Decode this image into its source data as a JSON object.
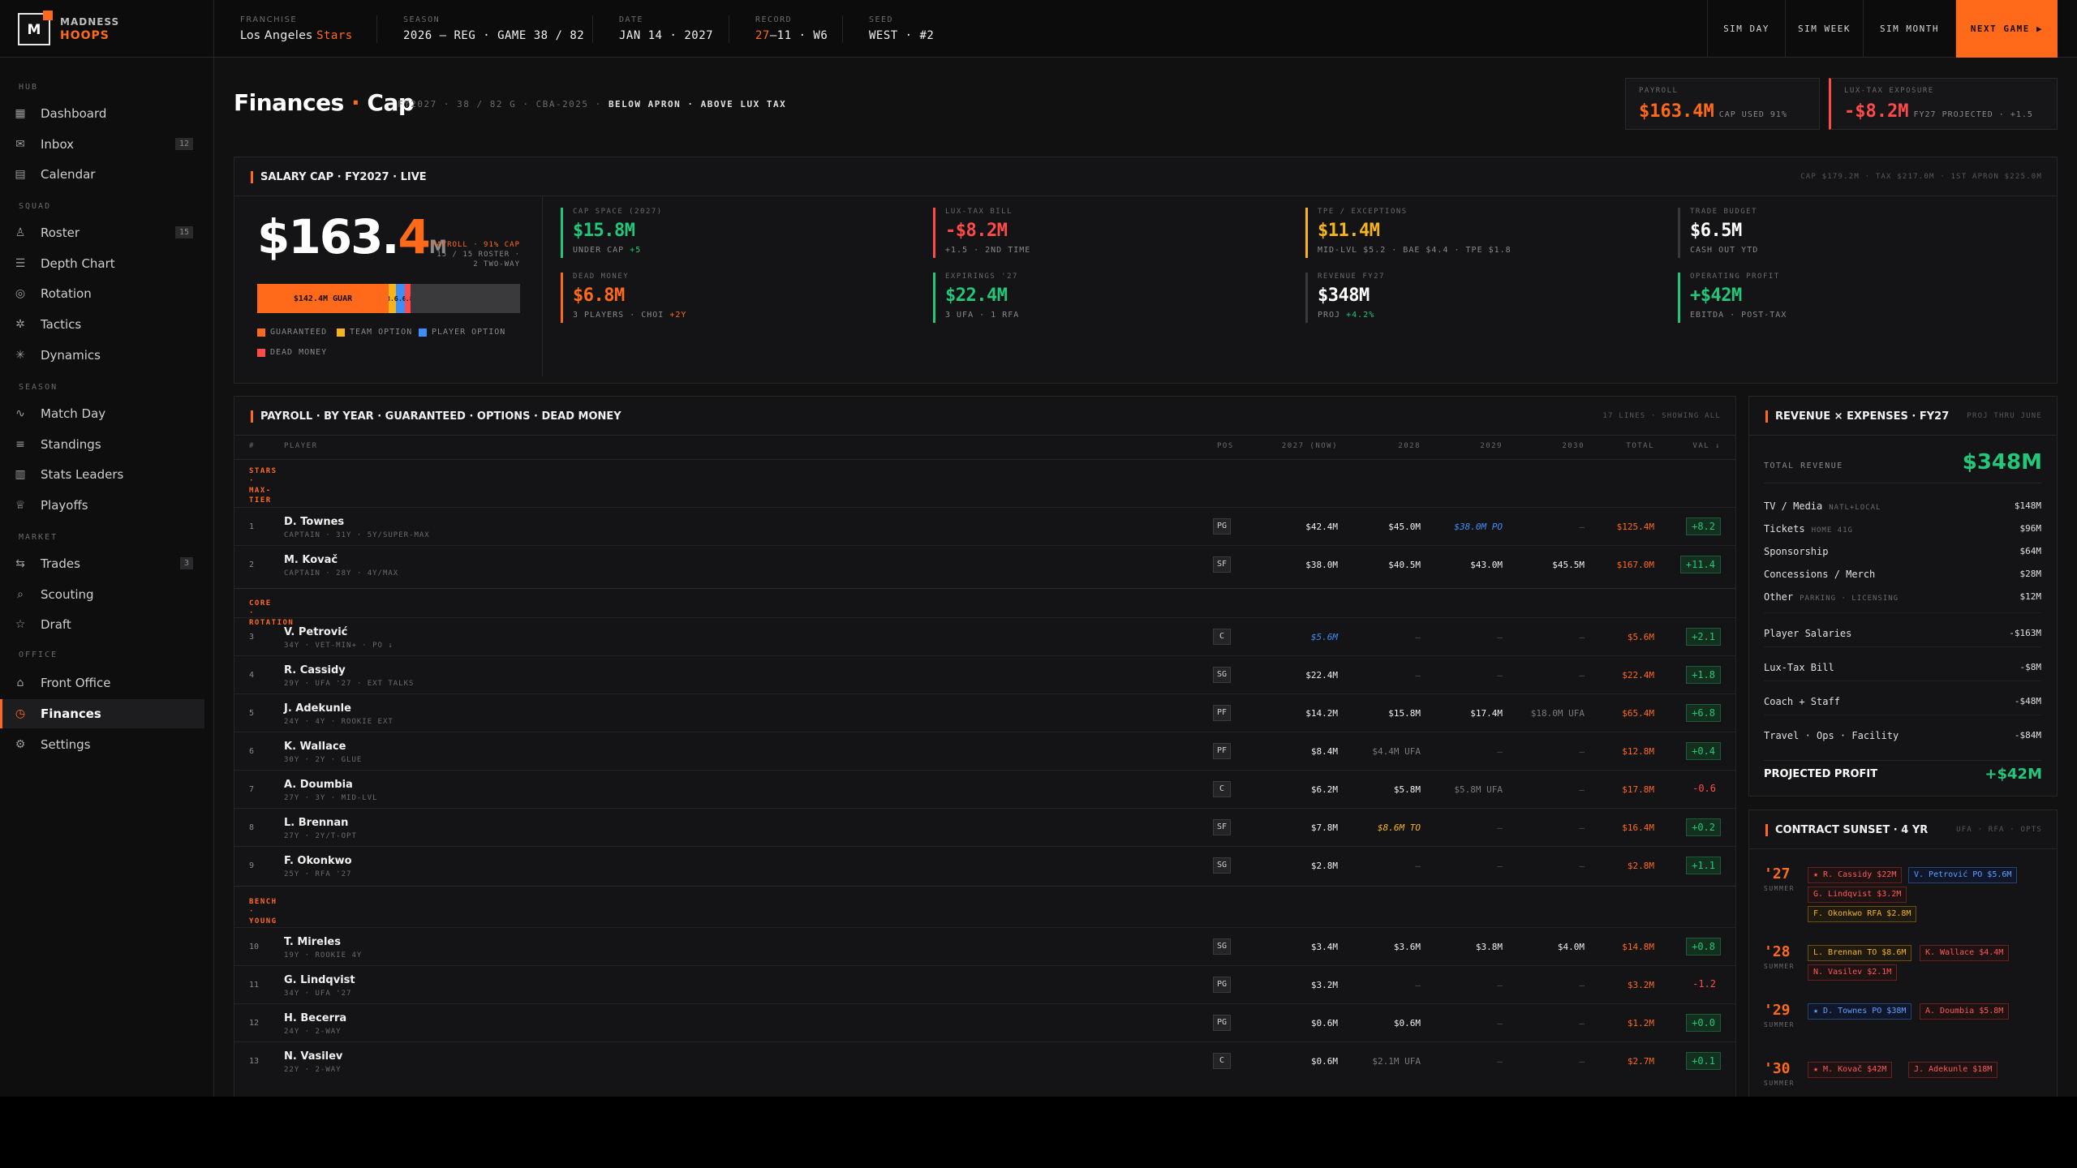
{
  "brand": {
    "line1": "MADNESS",
    "line2": "HOOPS",
    "mark": "M"
  },
  "topbar": {
    "franchise_label": "FRANCHISE",
    "franchise_city": "Los Angeles",
    "franchise_team": "Stars",
    "season_label": "SEASON",
    "season_value": "2026 — REG · GAME 38 / 82",
    "date_label": "DATE",
    "date_value": "JAN 14 · 2027",
    "record_label": "RECORD",
    "record_wins": "27",
    "record_rest": "–11 · W6",
    "seed_label": "SEED",
    "seed_value": "WEST · #2",
    "buttons": {
      "sim_day": "SIM DAY",
      "sim_week": "SIM WEEK",
      "sim_month": "SIM MONTH",
      "next_game": "NEXT GAME ▶"
    }
  },
  "sidebar": {
    "sections": {
      "hub": "HUB",
      "squad": "SQUAD",
      "season": "SEASON",
      "market": "MARKET",
      "office": "OFFICE"
    },
    "items": [
      {
        "label": "Dashboard",
        "icon": "grid-icon"
      },
      {
        "label": "Inbox",
        "icon": "mail-icon",
        "badge": "12"
      },
      {
        "label": "Calendar",
        "icon": "calendar-icon"
      },
      {
        "label": "Roster",
        "icon": "person-icon",
        "badge": "15"
      },
      {
        "label": "Depth Chart",
        "icon": "layers-icon"
      },
      {
        "label": "Rotation",
        "icon": "rotation-icon"
      },
      {
        "label": "Tactics",
        "icon": "tactics-icon"
      },
      {
        "label": "Dynamics",
        "icon": "dynamics-icon"
      },
      {
        "label": "Match Day",
        "icon": "pulse-icon"
      },
      {
        "label": "Standings",
        "icon": "list-icon"
      },
      {
        "label": "Stats Leaders",
        "icon": "bars-icon"
      },
      {
        "label": "Playoffs",
        "icon": "trophy-icon"
      },
      {
        "label": "Trades",
        "icon": "swap-icon",
        "badge": "3"
      },
      {
        "label": "Scouting",
        "icon": "search-icon"
      },
      {
        "label": "Draft",
        "icon": "star-icon"
      },
      {
        "label": "Front Office",
        "icon": "building-icon"
      },
      {
        "label": "Finances",
        "icon": "clock-icon"
      },
      {
        "label": "Settings",
        "icon": "gear-icon"
      }
    ]
  },
  "header": {
    "title_a": "Finances",
    "title_dot": "·",
    "title_b": "Cap",
    "meta": "FY2027 · 38 / 82 G · CBA-2025 ·",
    "meta_bold": "BELOW APRON · ABOVE LUX TAX",
    "kpi_payroll": {
      "label": "PAYROLL",
      "value": "$163.4M",
      "sub": "CAP USED 91%"
    },
    "kpi_tax": {
      "label": "LUX-TAX EXPOSURE",
      "value": "-$8.2M",
      "sub": "FY27 PROJECTED · +1.5"
    }
  },
  "cap": {
    "title": "SALARY CAP · FY2027 · LIVE",
    "right": "CAP $179.2M · TAX $217.0M · 1ST APRON $225.0M",
    "big_int": "$163.",
    "big_dec": "4",
    "big_unit": "M",
    "note_a": "PAYROLL · 91% CAP",
    "note_b": "15 / 15 ROSTER ·",
    "note_c": "2 TWO-WAY",
    "bar": [
      {
        "label": "$142.4M GUAR",
        "pct": 0.5,
        "color": "#ff6a1a"
      },
      {
        "label": "$8.6M TO",
        "pct": 0.027,
        "color": "#f5b51a"
      },
      {
        "label": "$5.6M PO",
        "pct": 0.035,
        "color": "#3e8ef7"
      },
      {
        "label": "$6.8M DM",
        "pct": 0.02,
        "color": "#ff4a4a"
      }
    ],
    "bar_labels": {
      "l1": "$142.4M GUAR",
      "l2": "$8.6M",
      "l3": "$5.6M",
      "l4": "$6.8M"
    },
    "legend": {
      "guaranteed": "GUARANTEED",
      "team_option": "TEAM OPTION",
      "player_option": "PLAYER OPTION",
      "dead_money": "DEAD MONEY"
    },
    "stats": [
      {
        "label": "CAP SPACE (2027)",
        "value": "$15.8M",
        "sub": "UNDER CAP",
        "sub_extra": "+5"
      },
      {
        "label": "LUX-TAX BILL",
        "value": "-$8.2M",
        "sub": "+1.5 · 2ND TIME"
      },
      {
        "label": "TPE / EXCEPTIONS",
        "value": "$11.4M",
        "sub": "MID-LVL $5.2 · BAE $4.4 · TPE $1.8"
      },
      {
        "label": "TRADE BUDGET",
        "value": "$6.5M",
        "sub": "CASH OUT YTD"
      },
      {
        "label": "DEAD MONEY",
        "value": "$6.8M",
        "sub": "3 PLAYERS · CHOI",
        "sub_extra": "+2Y"
      },
      {
        "label": "EXPIRINGS '27",
        "value": "$22.4M",
        "sub": "3 UFA · 1 RFA"
      },
      {
        "label": "REVENUE FY27",
        "value": "$348M",
        "sub": "PROJ",
        "sub_extra": "+4.2%"
      },
      {
        "label": "OPERATING PROFIT",
        "value": "+$42M",
        "sub": "EBITDA · POST-TAX"
      }
    ]
  },
  "payroll": {
    "title": "PAYROLL · BY YEAR · GUARANTEED · OPTIONS · DEAD MONEY",
    "right": "17 LINES · SHOWING ALL",
    "headers": {
      "num": "#",
      "player": "PLAYER",
      "pos": "POS",
      "y2027": "2027 (NOW)",
      "y2028": "2028",
      "y2029": "2029",
      "y2030": "2030",
      "total": "TOTAL",
      "val": "VAL ↓"
    },
    "groups": {
      "stars": [
        "STARS",
        "·",
        "MAX-",
        "TIER"
      ],
      "core": [
        "CORE",
        "·",
        "ROTATION"
      ],
      "bench": [
        "BENCH",
        "·",
        "YOUNG"
      ]
    },
    "rows": [
      {
        "n": "1",
        "name": "D. Townes",
        "meta": "CAPTAIN · 31Y · 5Y/SUPER-MAX",
        "pos": "PG",
        "y27": "$42.4M",
        "y28": "$45.0M",
        "y29": "$38.0M PO",
        "y30": "—",
        "total": "$125.4M",
        "val": "+8.2"
      },
      {
        "n": "2",
        "name": "M. Kovač",
        "meta": "CAPTAIN · 28Y · 4Y/MAX",
        "pos": "SF",
        "y27": "$38.0M",
        "y28": "$40.5M",
        "y29": "$43.0M",
        "y30": "$45.5M",
        "total": "$167.0M",
        "val": "+11.4"
      },
      {
        "n": "3",
        "name": "V. Petrović",
        "meta": "34Y · VET-MIN+ · PO ↓",
        "pos": "C",
        "y27": "$5.6M",
        "y28": "—",
        "y29": "—",
        "y30": "—",
        "total": "$5.6M",
        "val": "+2.1"
      },
      {
        "n": "4",
        "name": "R. Cassidy",
        "meta": "29Y · UFA '27 · EXT TALKS",
        "pos": "SG",
        "y27": "$22.4M",
        "y28": "—",
        "y29": "—",
        "y30": "—",
        "total": "$22.4M",
        "val": "+1.8"
      },
      {
        "n": "5",
        "name": "J. Adekunle",
        "meta": "24Y · 4Y · ROOKIE EXT",
        "pos": "PF",
        "y27": "$14.2M",
        "y28": "$15.8M",
        "y29": "$17.4M",
        "y30": "$18.0M UFA",
        "total": "$65.4M",
        "val": "+6.8"
      },
      {
        "n": "6",
        "name": "K. Wallace",
        "meta": "30Y · 2Y · GLUE",
        "pos": "PF",
        "y27": "$8.4M",
        "y28": "$4.4M UFA",
        "y29": "—",
        "y30": "—",
        "total": "$12.8M",
        "val": "+0.4"
      },
      {
        "n": "7",
        "name": "A. Doumbia",
        "meta": "27Y · 3Y · MID-LVL",
        "pos": "C",
        "y27": "$6.2M",
        "y28": "$5.8M",
        "y29": "$5.8M UFA",
        "y30": "—",
        "total": "$17.8M",
        "val": "-0.6"
      },
      {
        "n": "8",
        "name": "L. Brennan",
        "meta": "27Y · 2Y/T-OPT",
        "pos": "SF",
        "y27": "$7.8M",
        "y28": "$8.6M TO",
        "y29": "—",
        "y30": "—",
        "total": "$16.4M",
        "val": "+0.2"
      },
      {
        "n": "9",
        "name": "F. Okonkwo",
        "meta": "25Y · RFA '27",
        "pos": "SG",
        "y27": "$2.8M",
        "y28": "—",
        "y29": "—",
        "y30": "—",
        "total": "$2.8M",
        "val": "+1.1"
      },
      {
        "n": "10",
        "name": "T. Mireles",
        "meta": "19Y · ROOKIE 4Y",
        "pos": "SG",
        "y27": "$3.4M",
        "y28": "$3.6M",
        "y29": "$3.8M",
        "y30": "$4.0M",
        "total": "$14.8M",
        "val": "+0.8"
      },
      {
        "n": "11",
        "name": "G. Lindqvist",
        "meta": "34Y · UFA '27",
        "pos": "PG",
        "y27": "$3.2M",
        "y28": "—",
        "y29": "—",
        "y30": "—",
        "total": "$3.2M",
        "val": "-1.2"
      },
      {
        "n": "12",
        "name": "H. Becerra",
        "meta": "24Y · 2-WAY",
        "pos": "PG",
        "y27": "$0.6M",
        "y28": "$0.6M",
        "y29": "—",
        "y30": "—",
        "total": "$1.2M",
        "val": "+0.0"
      },
      {
        "n": "13",
        "name": "N. Vasilev",
        "meta": "22Y · 2-WAY",
        "pos": "C",
        "y27": "$0.6M",
        "y28": "$2.1M UFA",
        "y29": "—",
        "y30": "—",
        "total": "$2.7M",
        "val": "+0.1"
      }
    ]
  },
  "revenue": {
    "title": "REVENUE × EXPENSES · FY27",
    "right": "PROJ THRU JUNE",
    "total_label": "TOTAL REVENUE",
    "total_value": "$348M",
    "lines": [
      {
        "label": "TV / Media",
        "sub": "NATL+LOCAL",
        "amt": "$148M"
      },
      {
        "label": "Tickets",
        "sub": "HOME 41G",
        "amt": "$96M"
      },
      {
        "label": "Sponsorship",
        "sub": "",
        "amt": "$64M"
      },
      {
        "label": "Concessions / Merch",
        "sub": "",
        "amt": "$28M"
      },
      {
        "label": "Other",
        "sub": "PARKING · LICENSING",
        "amt": "$12M"
      },
      {
        "label": "Player Salaries",
        "sub": "",
        "amt": "-$163M"
      },
      {
        "label": "Lux-Tax Bill",
        "sub": "",
        "amt": "-$8M"
      },
      {
        "label": "Coach + Staff",
        "sub": "",
        "amt": "-$48M"
      },
      {
        "label": "Travel · Ops · Facility",
        "sub": "",
        "amt": "-$84M"
      }
    ],
    "profit_label": "PROJECTED PROFIT",
    "profit_value": "+$42M"
  },
  "sunset": {
    "title": "CONTRACT SUNSET · 4 YR",
    "right": "UFA · RFA · OPTS",
    "years": [
      {
        "year": "'27",
        "sub": "SUMMER",
        "chips": [
          "★ R. Cassidy $22M",
          "V. Petrović PO $5.6M",
          "G. Lindqvist $3.2M",
          "F. Okonkwo RFA $2.8M"
        ]
      },
      {
        "year": "'28",
        "sub": "SUMMER",
        "chips": [
          "L. Brennan TO $8.6M",
          "K. Wallace $4.4M",
          "N. Vasilev $2.1M"
        ]
      },
      {
        "year": "'29",
        "sub": "SUMMER",
        "chips": [
          "★ D. Townes PO $38M",
          "A. Doumbia $5.8M"
        ]
      },
      {
        "year": "'30",
        "sub": "SUMMER",
        "chips": [
          "★ M. Kovač $42M",
          "J. Adekunle $18M"
        ]
      }
    ]
  }
}
